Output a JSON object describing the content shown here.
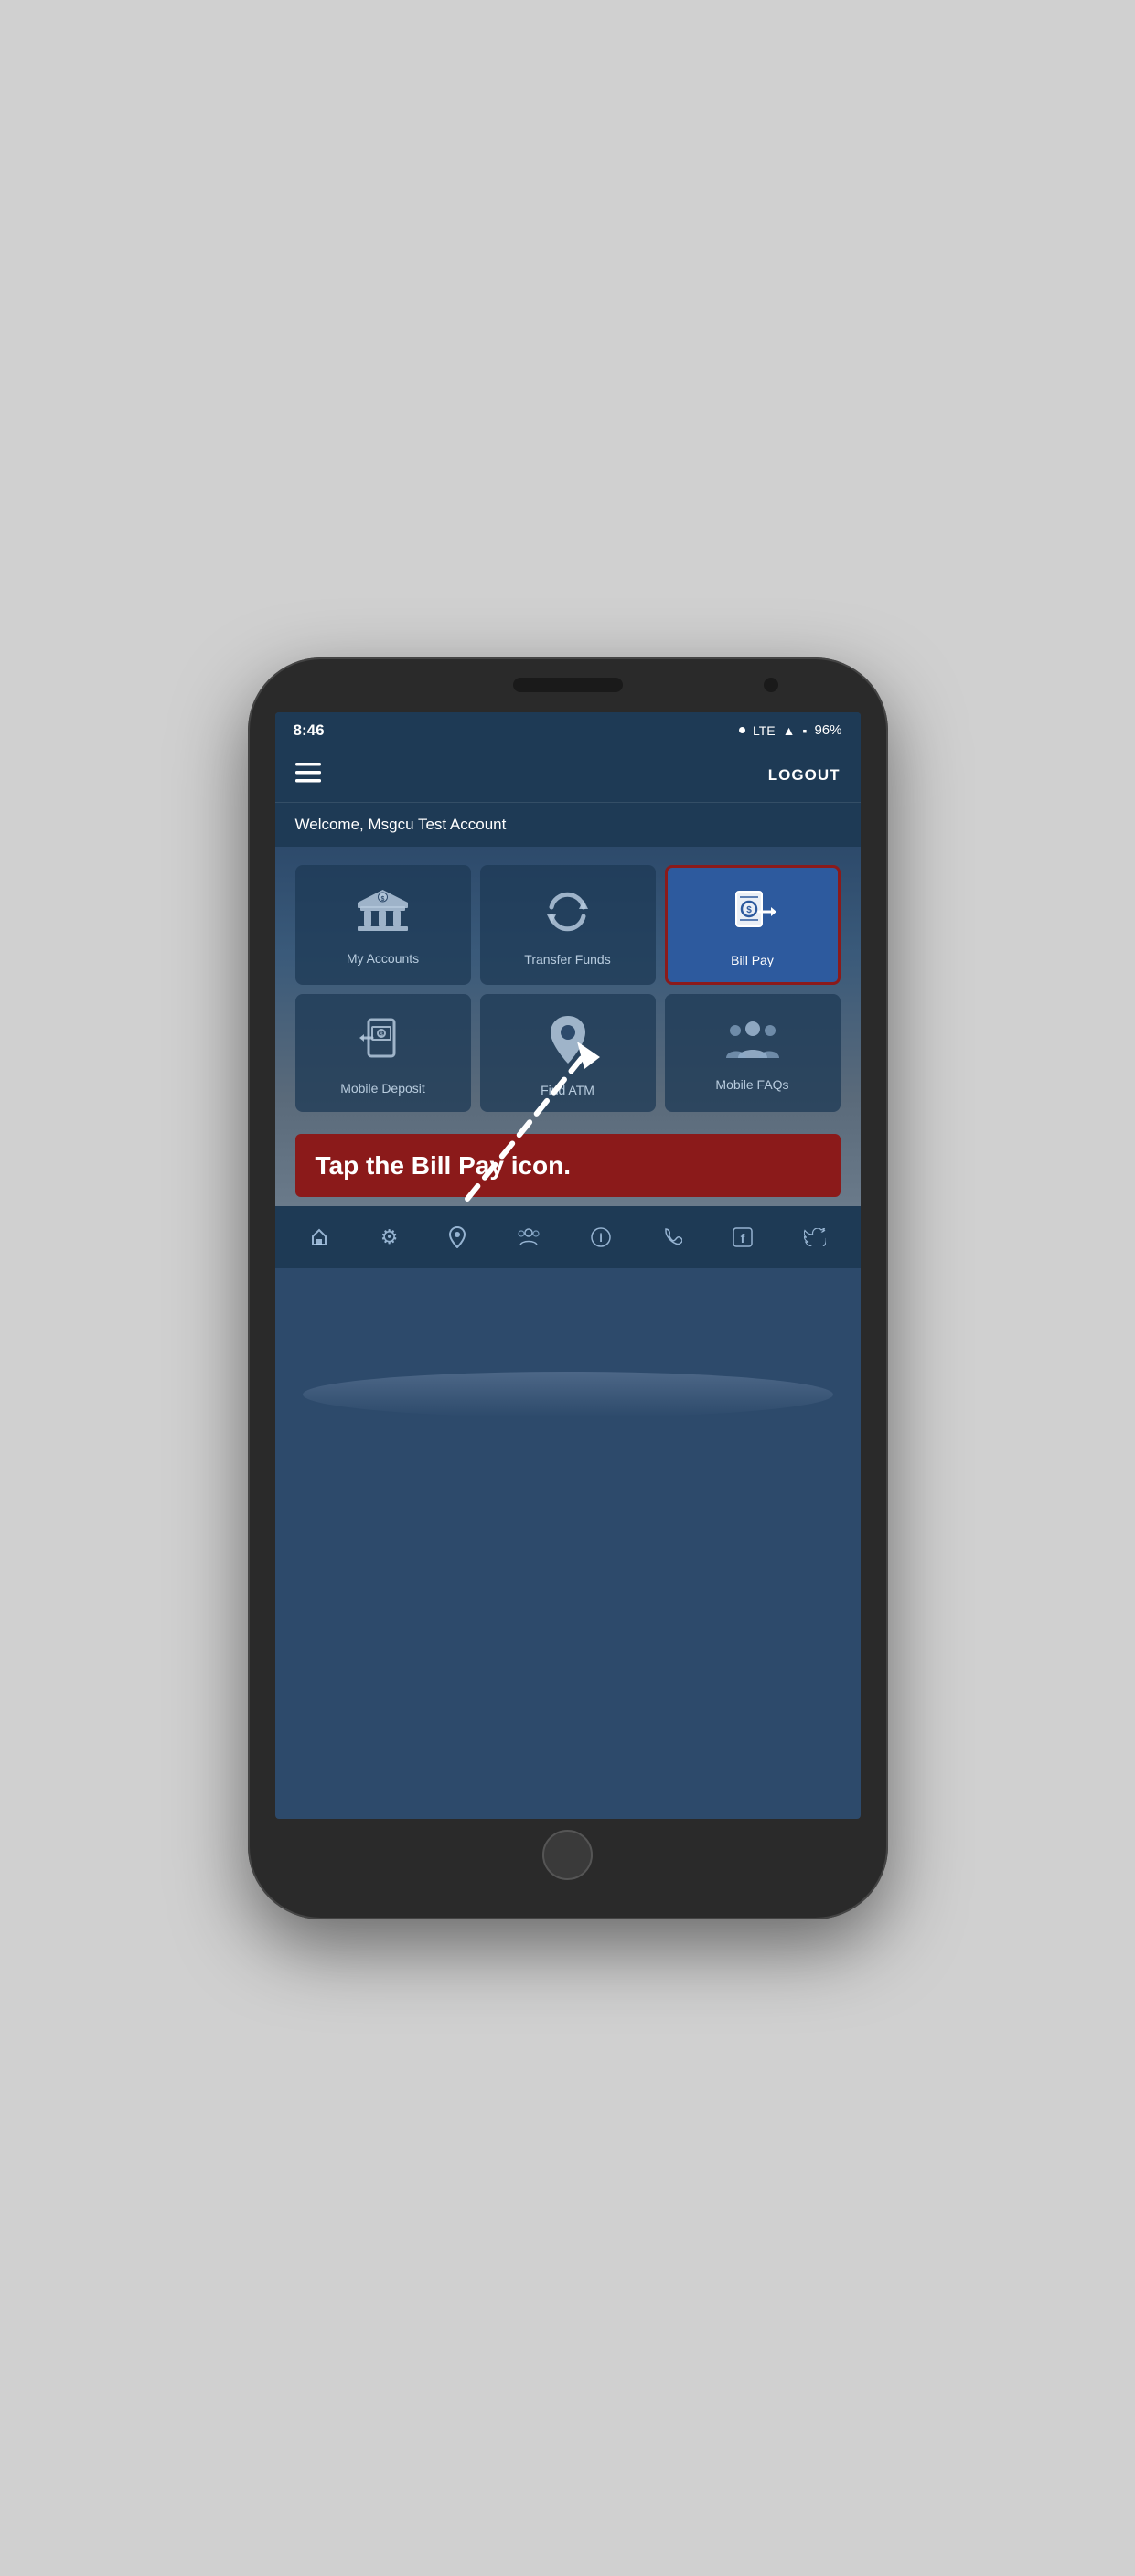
{
  "phone": {
    "status_bar": {
      "time": "8:46",
      "signal_dot": "•",
      "lte": "LTE",
      "signal": "▲",
      "battery_percent": "96%"
    },
    "header": {
      "logout_label": "LOGOUT"
    },
    "welcome": {
      "text": "Welcome, Msgcu Test Account"
    },
    "grid": {
      "items": [
        {
          "id": "my-accounts",
          "label": "My Accounts",
          "icon": "bank"
        },
        {
          "id": "transfer-funds",
          "label": "Transfer Funds",
          "icon": "transfer"
        },
        {
          "id": "bill-pay",
          "label": "Bill Pay",
          "icon": "billpay",
          "highlighted": true
        },
        {
          "id": "mobile-deposit",
          "label": "Mobile Deposit",
          "icon": "deposit"
        },
        {
          "id": "find-atm",
          "label": "Find ATM",
          "icon": "atm"
        },
        {
          "id": "mobile-faqs",
          "label": "Mobile FAQs",
          "icon": "faq"
        }
      ]
    },
    "instruction": {
      "text": "Tap the Bill Pay icon."
    },
    "bottom_tabs": [
      {
        "id": "home",
        "icon": "◆"
      },
      {
        "id": "settings",
        "icon": "⚙"
      },
      {
        "id": "location",
        "icon": "📍"
      },
      {
        "id": "people",
        "icon": "👥"
      },
      {
        "id": "info",
        "icon": "ℹ"
      },
      {
        "id": "phone",
        "icon": "📞"
      },
      {
        "id": "facebook",
        "icon": "f"
      },
      {
        "id": "twitter",
        "icon": "🐦"
      }
    ]
  },
  "colors": {
    "highlight_border": "#8b1a1a",
    "highlight_bg": "#2d5a9e",
    "banner_bg": "#8b1a1a",
    "header_bg": "#1e3a55",
    "screen_bg": "#2d4a6b"
  }
}
